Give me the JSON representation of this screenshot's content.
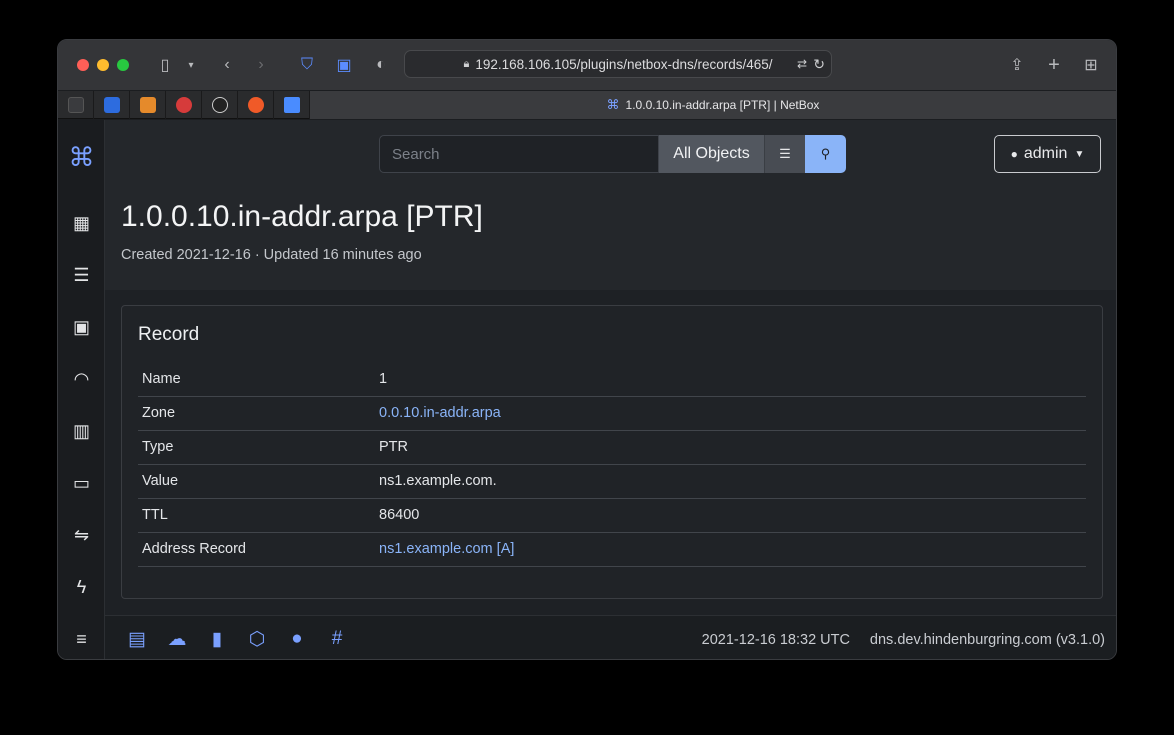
{
  "browser": {
    "url": "192.168.106.105/plugins/netbox-dns/records/465/",
    "active_tab_title": "1.0.0.10.in-addr.arpa [PTR] | NetBox",
    "pinned_tabs": [
      {
        "icon": "generic-app-icon",
        "color": "#3a3b3e"
      },
      {
        "icon": "google-icon",
        "color": "#2d6cdf"
      },
      {
        "icon": "chart-app-icon",
        "color": "#e58a2b"
      },
      {
        "icon": "red-circle-app-icon",
        "color": "#d63b3b"
      },
      {
        "icon": "m-circle-app-icon",
        "color": "#222222"
      },
      {
        "icon": "grafana-icon",
        "color": "#f05a28"
      },
      {
        "icon": "netbox-icon",
        "color": "#4a8cff"
      }
    ]
  },
  "search": {
    "placeholder": "Search",
    "scope": "All Objects"
  },
  "user_menu": {
    "label": "admin"
  },
  "page": {
    "title": "1.0.0.10.in-addr.arpa [PTR]",
    "subtitle": "Created 2021-12-16 · Updated 16 minutes ago"
  },
  "record_card": {
    "title": "Record",
    "rows": [
      {
        "label": "Name",
        "value": "1",
        "link": false
      },
      {
        "label": "Zone",
        "value": "0.0.10.in-addr.arpa",
        "link": true
      },
      {
        "label": "Type",
        "value": "PTR",
        "link": false
      },
      {
        "label": "Value",
        "value": "ns1.example.com.",
        "link": false
      },
      {
        "label": "TTL",
        "value": "86400",
        "link": false
      },
      {
        "label": "Address Record",
        "value": "ns1.example.com [A]",
        "link": true
      }
    ]
  },
  "sidebar": {
    "icons": [
      "netbox-logo-icon",
      "organization-icon",
      "devices-icon",
      "connections-icon",
      "wireless-icon",
      "ipam-icon",
      "virtualization-icon",
      "circuits-icon",
      "power-icon",
      "other-icon"
    ]
  },
  "footer": {
    "timestamp": "2021-12-16 18:32 UTC",
    "host": "dns.dev.hindenburgring.com (v3.1.0)",
    "icons": [
      "docs-icon",
      "rest-api-icon",
      "api-docs-icon",
      "graphql-icon",
      "github-icon",
      "slack-icon"
    ]
  },
  "colors": {
    "accent": "#8ab4f8",
    "background": "#1e2125"
  }
}
